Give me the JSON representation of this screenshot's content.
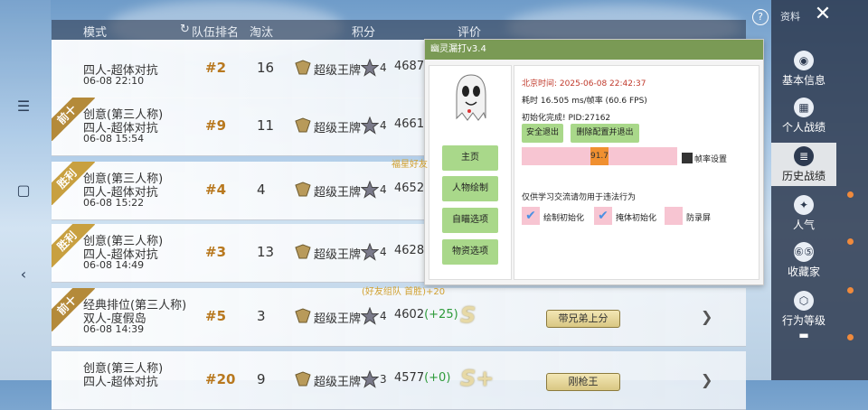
{
  "header": {
    "mode": "模式",
    "team_rank": "队伍排名",
    "eliminations": "淘汰",
    "points": "积分",
    "rating": "评价"
  },
  "rows": [
    {
      "ribbon": "",
      "mode1": "四人-超体对抗",
      "mode2": "",
      "date": "06-08 22:10",
      "rank": "#2",
      "elim": "16",
      "tier": "超级王牌",
      "tier_num": "4",
      "score": "4687",
      "delta": "",
      "grade": "",
      "title": ""
    },
    {
      "ribbon": "前十",
      "mode1": "创意(第三人称)",
      "mode2": "四人-超体对抗",
      "date": "06-08 15:54",
      "rank": "#9",
      "elim": "11",
      "tier": "超级王牌",
      "tier_num": "4",
      "score": "4661",
      "delta": "",
      "grade": "",
      "title": ""
    },
    {
      "ribbon": "胜利",
      "mode1": "创意(第三人称)",
      "mode2": "四人-超体对抗",
      "date": "06-08 15:22",
      "rank": "#4",
      "elim": "4",
      "tier": "超级王牌",
      "tier_num": "4",
      "score": "4652",
      "delta": "",
      "grade": "",
      "title": ""
    },
    {
      "ribbon": "胜利",
      "mode1": "创意(第三人称)",
      "mode2": "四人-超体对抗",
      "date": "06-08 14:49",
      "rank": "#3",
      "elim": "13",
      "tier": "超级王牌",
      "tier_num": "4",
      "score": "4628",
      "delta": "",
      "grade": "",
      "title": ""
    },
    {
      "ribbon": "前十",
      "mode1": "经典排位(第三人称)",
      "mode2": "双人-度假岛",
      "date": "06-08 14:39",
      "rank": "#5",
      "elim": "3",
      "tier": "超级王牌",
      "tier_num": "4",
      "score": "4602",
      "delta": "(+25)",
      "grade": "S",
      "title": "带兄弟上分"
    },
    {
      "ribbon": "",
      "mode1": "创意(第三人称)",
      "mode2": "四人-超体对抗",
      "date": "",
      "rank": "#20",
      "elim": "9",
      "tier": "超级王牌",
      "tier_num": "3",
      "score": "4577",
      "delta": "(+0)",
      "grade": "S+",
      "title": "刚枪王"
    }
  ],
  "notes": {
    "friend_team": "(好友组队 首胜)+20",
    "partial": "福星好友"
  },
  "right_nav": {
    "top_label": "资料",
    "items": [
      "基本信息",
      "个人战绩",
      "历史战绩",
      "人气",
      "收藏家",
      "行为等级"
    ],
    "active_index": 2
  },
  "overlay": {
    "title": "幽灵漏打v3.4",
    "menu": [
      "主页",
      "人物绘制",
      "自瞄选项",
      "物资选项"
    ],
    "beijing_time": "北京时间: 2025-06-08 22:42:37",
    "timing": "耗时 16.505 ms/帧率 (60.6 FPS)",
    "init_done": "初始化完成! PID:27162",
    "btn_exit": "安全退出",
    "btn_delete": "删除配置并退出",
    "slider_value": "91.7",
    "slider_fraction": 0.5,
    "fps_setting": "帧率设置",
    "disclaimer": "仅供学习交流请勿用于违法行为",
    "checkboxes": [
      {
        "label": "绘制初始化",
        "checked": true
      },
      {
        "label": "掩体初始化",
        "checked": true
      },
      {
        "label": "防录屏",
        "checked": false
      }
    ]
  },
  "colors": {
    "panel_title_bg": "#7a9a55",
    "menu_green": "#a9d88a",
    "pink": "#f7c5d2",
    "orange_thumb": "#f09030",
    "ribbon_gold": "#c8a040",
    "rank_color": "#b8781e"
  }
}
